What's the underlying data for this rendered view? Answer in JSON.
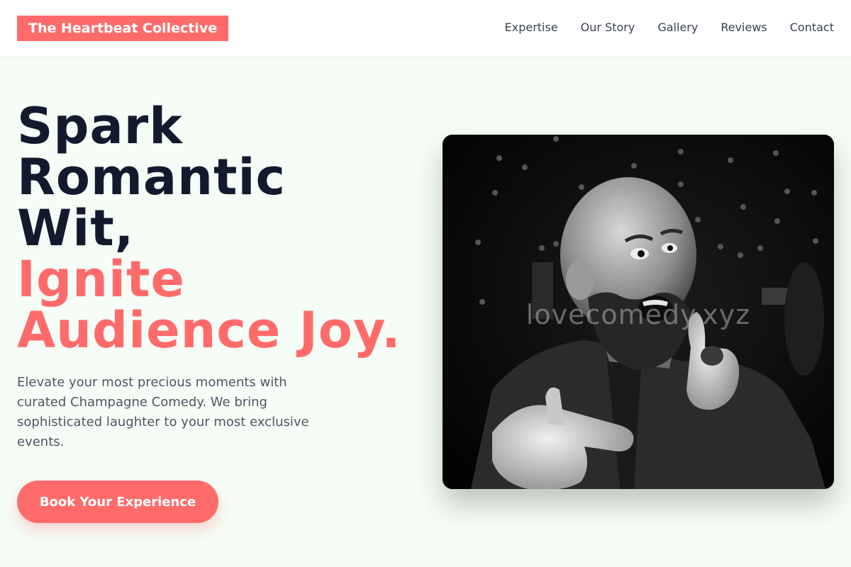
{
  "header": {
    "logo": "The Heartbeat Collective",
    "nav": [
      "Expertise",
      "Our Story",
      "Gallery",
      "Reviews",
      "Contact"
    ]
  },
  "hero": {
    "title_dark": [
      "Spark",
      "Romantic",
      "Wit,"
    ],
    "title_accent": [
      "Ignite",
      "Audience Joy."
    ],
    "subtitle": "Elevate your most precious moments with curated Champagne Comedy. We bring sophisticated laughter to your most exclusive events.",
    "cta_label": "Book Your Experience",
    "image_watermark": "lovecomedy.xyz"
  },
  "colors": {
    "accent": "#ff6b6b",
    "heading": "#141a2e",
    "body_text": "#4f5666",
    "background": "#f5fdf6"
  }
}
